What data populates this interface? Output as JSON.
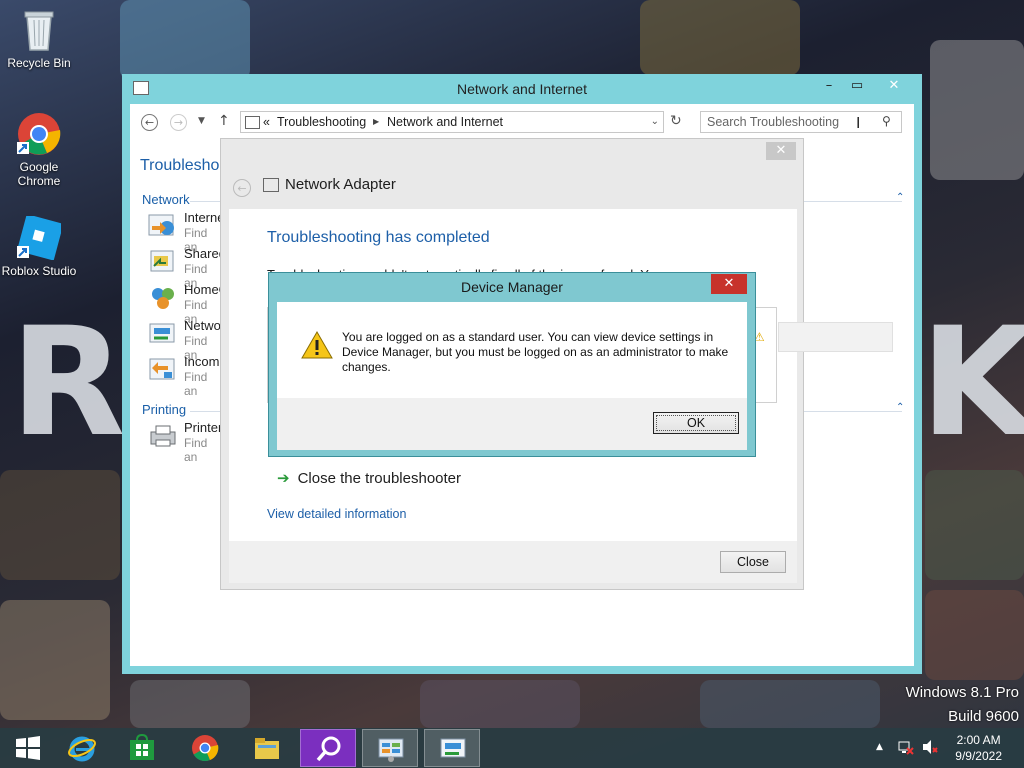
{
  "desktop": {
    "icons": [
      {
        "label": "Recycle Bin",
        "icon": "recycle-bin-icon"
      },
      {
        "label": "Google Chrome",
        "label_line1": "Google",
        "label_line2": "Chrome",
        "icon": "chrome-icon"
      },
      {
        "label": "Roblox Studio",
        "icon": "roblox-studio-icon"
      }
    ],
    "watermark": {
      "line1": "Windows 8.1 Pro",
      "line2": "Build 9600"
    }
  },
  "explorer": {
    "title": "Network and Internet",
    "breadcrumb": [
      "Troubleshooting",
      "Network and Internet"
    ],
    "breadcrumb_prefix": "«",
    "search_placeholder": "Search Troubleshooting",
    "page_title": "Troubleshoo",
    "sections": [
      {
        "title": "Network",
        "items": [
          {
            "name": "Interne",
            "desc": "Find an"
          },
          {
            "name": "Shared",
            "desc": "Find an"
          },
          {
            "name": "HomeG",
            "desc": "Find an"
          },
          {
            "name": "Netwo",
            "desc": "Find an"
          },
          {
            "name": "Incomi",
            "desc": "Find an"
          }
        ]
      },
      {
        "title": "Printing",
        "items": [
          {
            "name": "Printer",
            "desc": "Find an"
          }
        ]
      }
    ]
  },
  "troubleshooter": {
    "header": "Network Adapter",
    "heading": "Troubleshooting has completed",
    "description": "Troubleshooting couldn't automatically fix all of the issues found. You can find",
    "close_link": "Close the troubleshooter",
    "details_link": "View detailed information",
    "close_button": "Close"
  },
  "message_box": {
    "title": "Device Manager",
    "message": "You are logged on as a standard user. You can view device settings in Device Manager, but you must be logged on as an administrator to make changes.",
    "ok_button": "OK"
  },
  "taskbar": {
    "apps": [
      "start",
      "internet-explorer",
      "store",
      "chrome",
      "file-explorer",
      "search",
      "control-panel",
      "network-adapter"
    ],
    "clock": {
      "time": "2:00 AM",
      "date": "9/9/2022"
    }
  },
  "colors": {
    "accent": "#7fd3dc",
    "link": "#1d5fa8",
    "close_red": "#c7332b"
  }
}
